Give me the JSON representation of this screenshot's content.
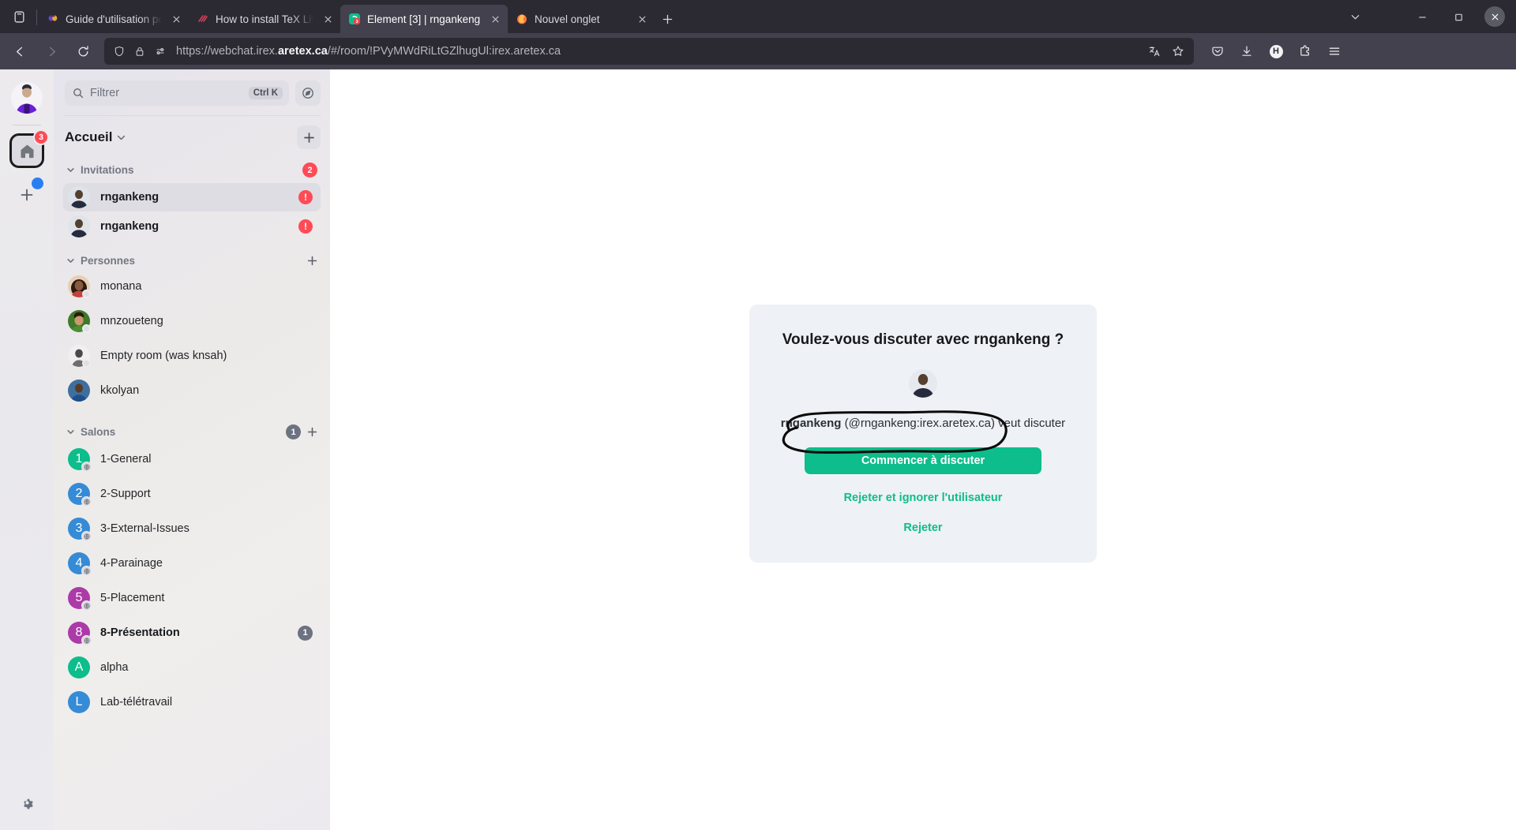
{
  "browser": {
    "tabs": [
      {
        "title": "Guide d'utilisation pour a",
        "favicon": "pin-icon",
        "active": false,
        "close_label": "×"
      },
      {
        "title": "How to install TeX Live an",
        "favicon": "tex-icon",
        "active": false,
        "close_label": "×"
      },
      {
        "title": "Element [3] | rngankeng",
        "favicon": "element-icon",
        "badge": "3",
        "active": true,
        "close_label": "×"
      },
      {
        "title": "Nouvel onglet",
        "favicon": "firefox-icon",
        "active": false,
        "close_label": "×"
      }
    ],
    "new_tab_label": "+",
    "window_controls": {
      "list_all": "chevron-down-icon",
      "minimize": "–",
      "maximize": "□",
      "close": "×"
    },
    "nav": {
      "back": "back-arrow-icon",
      "forward": "forward-arrow-icon",
      "reload": "reload-icon"
    },
    "url": {
      "prefix": "https://webchat.irex.",
      "host": "aretex.ca",
      "suffix": "/#/room/!PVyMWdRiLtGZlhugUl:irex.aretex.ca",
      "full": "https://webchat.irex.aretex.ca/#/room/!PVyMWdRiLtGZlhugUl:irex.aretex.ca",
      "shield_icon": "shield-icon",
      "lock_icon": "lock-icon",
      "permissions_icon": "permissions-icon",
      "translate_icon": "translate-icon",
      "bookmark_icon": "star-icon"
    },
    "toolbar_right": {
      "pocket": "pocket-icon",
      "downloads": "download-icon",
      "account": "H",
      "extensions": "extensions-icon",
      "menu": "hamburger-menu-icon"
    }
  },
  "app": {
    "space_rail": {
      "user_avatar": "user-avatar",
      "home": {
        "icon": "home-icon",
        "badge": "3"
      },
      "add_space": {
        "icon": "plus-icon",
        "dot": true
      },
      "settings": "gear-icon"
    },
    "filter": {
      "placeholder": "Filtrer",
      "shortcut": "Ctrl K",
      "search_icon": "search-icon",
      "explore_icon": "compass-icon"
    },
    "space_header": {
      "name": "Accueil",
      "chevron": "chevron-down-icon",
      "add_label": "+"
    },
    "sections": [
      {
        "id": "invitations",
        "label": "Invitations",
        "badge": "2",
        "badge_type": "red",
        "has_add": false,
        "rows": [
          {
            "name": "rngankeng",
            "avatar_type": "photo-man",
            "selected": true,
            "bold": true,
            "alert": "!"
          },
          {
            "name": "rngankeng",
            "avatar_type": "photo-man",
            "selected": false,
            "bold": true,
            "alert": "!"
          }
        ]
      },
      {
        "id": "personnes",
        "label": "Personnes",
        "badge": null,
        "has_add": true,
        "rows": [
          {
            "name": "monana",
            "avatar_type": "photo-woman",
            "presence": true
          },
          {
            "name": "mnzoueteng",
            "avatar_type": "photo-green",
            "presence": true
          },
          {
            "name": "Empty room (was knsah)",
            "avatar_type": "photo-gray",
            "presence": true
          },
          {
            "name": "kkolyan",
            "avatar_type": "photo-blue",
            "presence": false
          }
        ]
      },
      {
        "id": "salons",
        "label": "Salons",
        "badge": "1",
        "badge_type": "gray",
        "has_add": true,
        "rows": [
          {
            "name": "1-General",
            "initial": "1",
            "color": "#0dbd8b",
            "public": true
          },
          {
            "name": "2-Support",
            "initial": "2",
            "color": "#368bd6",
            "public": true
          },
          {
            "name": "3-External-Issues",
            "initial": "3",
            "color": "#368bd6",
            "public": true
          },
          {
            "name": "4-Parainage",
            "initial": "4",
            "color": "#368bd6",
            "public": true
          },
          {
            "name": "5-Placement",
            "initial": "5",
            "color": "#ac3ba8",
            "public": true
          },
          {
            "name": "8-Présentation",
            "initial": "8",
            "color": "#ac3ba8",
            "public": true,
            "bold": true,
            "badge": "1"
          },
          {
            "name": "alpha",
            "initial": "A",
            "color": "#0dbd8b",
            "public": false
          },
          {
            "name": "Lab-télétravail",
            "initial": "L",
            "color": "#368bd6",
            "public": false
          }
        ]
      }
    ],
    "invite_card": {
      "title": "Voulez-vous discuter avec rngankeng ?",
      "avatar": "photo-man",
      "inviter_name": "rngankeng",
      "inviter_id": "(@rngankeng:irex.aretex.ca)",
      "inviter_suffix": "veut discuter",
      "accept_label": "Commencer à discuter",
      "ignore_label": "Rejeter et ignorer l'utilisateur",
      "reject_label": "Rejeter",
      "annotation": "hand-drawn-circle-around-accept-button"
    }
  },
  "colors": {
    "accent_green": "#0dbd8b",
    "alert_red": "#ff4b55",
    "badge_gray": "#6c7280",
    "card_bg": "#eef1f5",
    "browser_chrome": "#2b2a33",
    "navbar": "#42414d"
  }
}
